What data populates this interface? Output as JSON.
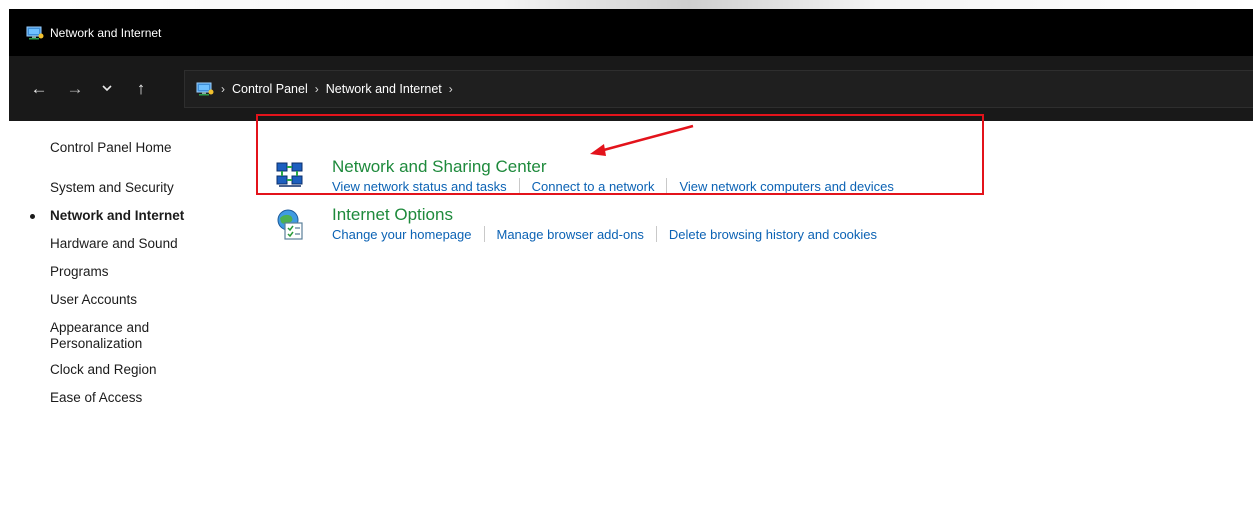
{
  "window": {
    "title": "Network and Internet",
    "icon": "control-panel-icon"
  },
  "navigation": {
    "back_glyph": "←",
    "forward_glyph": "→",
    "recent_glyph": "⌄",
    "up_glyph": "↑",
    "address_icon": "control-panel-icon",
    "separator": "›",
    "breadcrumbs": [
      "Control Panel",
      "Network and Internet"
    ]
  },
  "sidebar": {
    "items": [
      {
        "label": "Control Panel Home",
        "current": false
      },
      {
        "label": "System and Security",
        "current": false
      },
      {
        "label": "Network and Internet",
        "current": true
      },
      {
        "label": "Hardware and Sound",
        "current": false
      },
      {
        "label": "Programs",
        "current": false
      },
      {
        "label": "User Accounts",
        "current": false
      },
      {
        "label": "Appearance and\nPersonalization",
        "current": false
      },
      {
        "label": "Clock and Region",
        "current": false
      },
      {
        "label": "Ease of Access",
        "current": false
      }
    ]
  },
  "tasks": [
    {
      "title": "Network and Sharing Center",
      "icon": "network-sharing-icon",
      "links": [
        "View network status and tasks",
        "Connect to a network",
        "View network computers and devices"
      ]
    },
    {
      "title": "Internet Options",
      "icon": "internet-options-icon",
      "links": [
        "Change your homepage",
        "Manage browser add-ons",
        "Delete browsing history and cookies"
      ]
    }
  ],
  "annotation": {
    "highlight_color": "#e3131b"
  },
  "colors": {
    "titlebar": "#000000",
    "navbar": "#191919",
    "task_title": "#1e8a3c",
    "task_link": "#0b62b4"
  }
}
